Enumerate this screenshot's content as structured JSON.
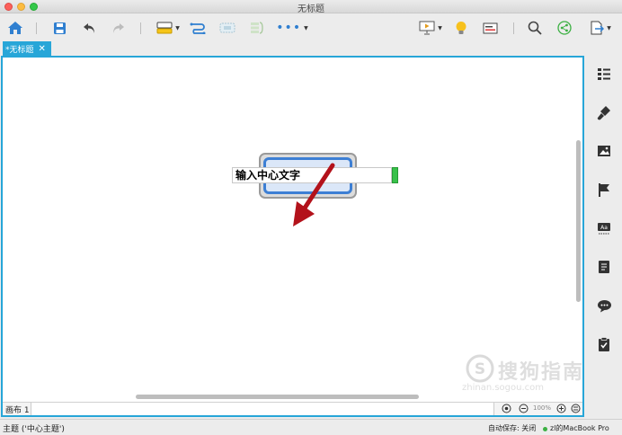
{
  "window": {
    "title": "无标题"
  },
  "tabs": [
    {
      "label": "*无标题",
      "close": "✕"
    }
  ],
  "canvas": {
    "central_topic": "输入中心文字",
    "sheet_label": "画布 1",
    "zoom_level": "100%"
  },
  "statusbar": {
    "topic": "主题 ('中心主题')",
    "autosave": "自动保存: 关闭",
    "device": "zl的MacBook Pro"
  },
  "colors": {
    "accent": "#27a6d8",
    "topic_border": "#3d7fd4",
    "topic_fill": "#dbe7f8",
    "arrow": "#b3121b",
    "handle": "#38c14a"
  },
  "toolbar_icons": [
    "home-icon",
    "save-icon",
    "undo-icon",
    "redo-icon",
    "topic-insert-icon",
    "relationship-icon",
    "boundary-icon",
    "summary-icon",
    "more-icon",
    "presentation-icon",
    "brainstorm-icon",
    "gantt-icon",
    "search-icon",
    "share-icon",
    "export-icon"
  ],
  "sidebar_icons": [
    "outline-icon",
    "format-icon",
    "image-icon",
    "marker-icon",
    "text-style-icon",
    "notes-icon",
    "comment-icon",
    "task-icon"
  ],
  "watermark": {
    "brand": "搜狗指南",
    "url": "zhinan.sogou.com"
  }
}
